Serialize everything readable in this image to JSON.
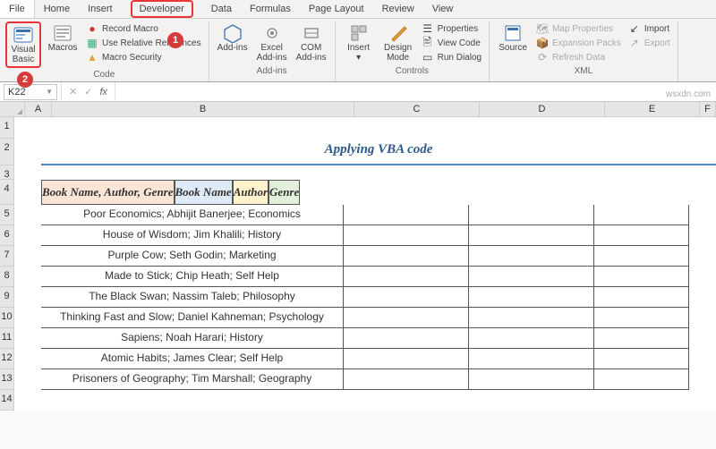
{
  "menu": [
    "File",
    "Home",
    "Insert",
    "Developer",
    "Data",
    "Formulas",
    "Page Layout",
    "Review",
    "View"
  ],
  "ribbon": {
    "code": {
      "vb": "Visual Basic",
      "macros": "Macros",
      "record": "Record Macro",
      "rel": "Use Relative References",
      "sec": "Macro Security",
      "label": "Code"
    },
    "addins": {
      "addins": "Add-ins",
      "excel": "Excel Add-ins",
      "com": "COM Add-ins",
      "label": "Add-ins"
    },
    "controls": {
      "insert": "Insert",
      "design": "Design Mode",
      "props": "Properties",
      "view": "View Code",
      "run": "Run Dialog",
      "label": "Controls"
    },
    "xml": {
      "source": "Source",
      "map": "Map Properties",
      "exp": "Expansion Packs",
      "refresh": "Refresh Data",
      "import": "Import",
      "export": "Export",
      "label": "XML"
    }
  },
  "badge1": "1",
  "badge2": "2",
  "namebox": "K22",
  "cols": {
    "A": "A",
    "B": "B",
    "C": "C",
    "D": "D",
    "E": "E",
    "F": "F"
  },
  "rows": [
    "1",
    "2",
    "3",
    "4",
    "5",
    "6",
    "7",
    "8",
    "9",
    "10",
    "11",
    "12",
    "13",
    "14"
  ],
  "title": "Applying VBA code",
  "headers": {
    "b": "Book Name, Author, Genre",
    "c": "Book Name",
    "d": "Author",
    "e": "Genre"
  },
  "data": [
    "   Poor Economics; Abhijit Banerjee; Economics",
    "House of Wisdom; Jim Khalili; History",
    "Purple Cow; Seth Godin; Marketing",
    "Made to Stick; Chip Heath; Self Help",
    "The Black Swan; Nassim Taleb; Philosophy",
    "Thinking Fast and Slow; Daniel Kahneman; Psychology",
    "Sapiens; Noah Harari; History",
    "Atomic Habits; James Clear; Self Help",
    "Prisoners of Geography; Tim Marshall; Geography"
  ],
  "watermark": "wsxdn.com"
}
